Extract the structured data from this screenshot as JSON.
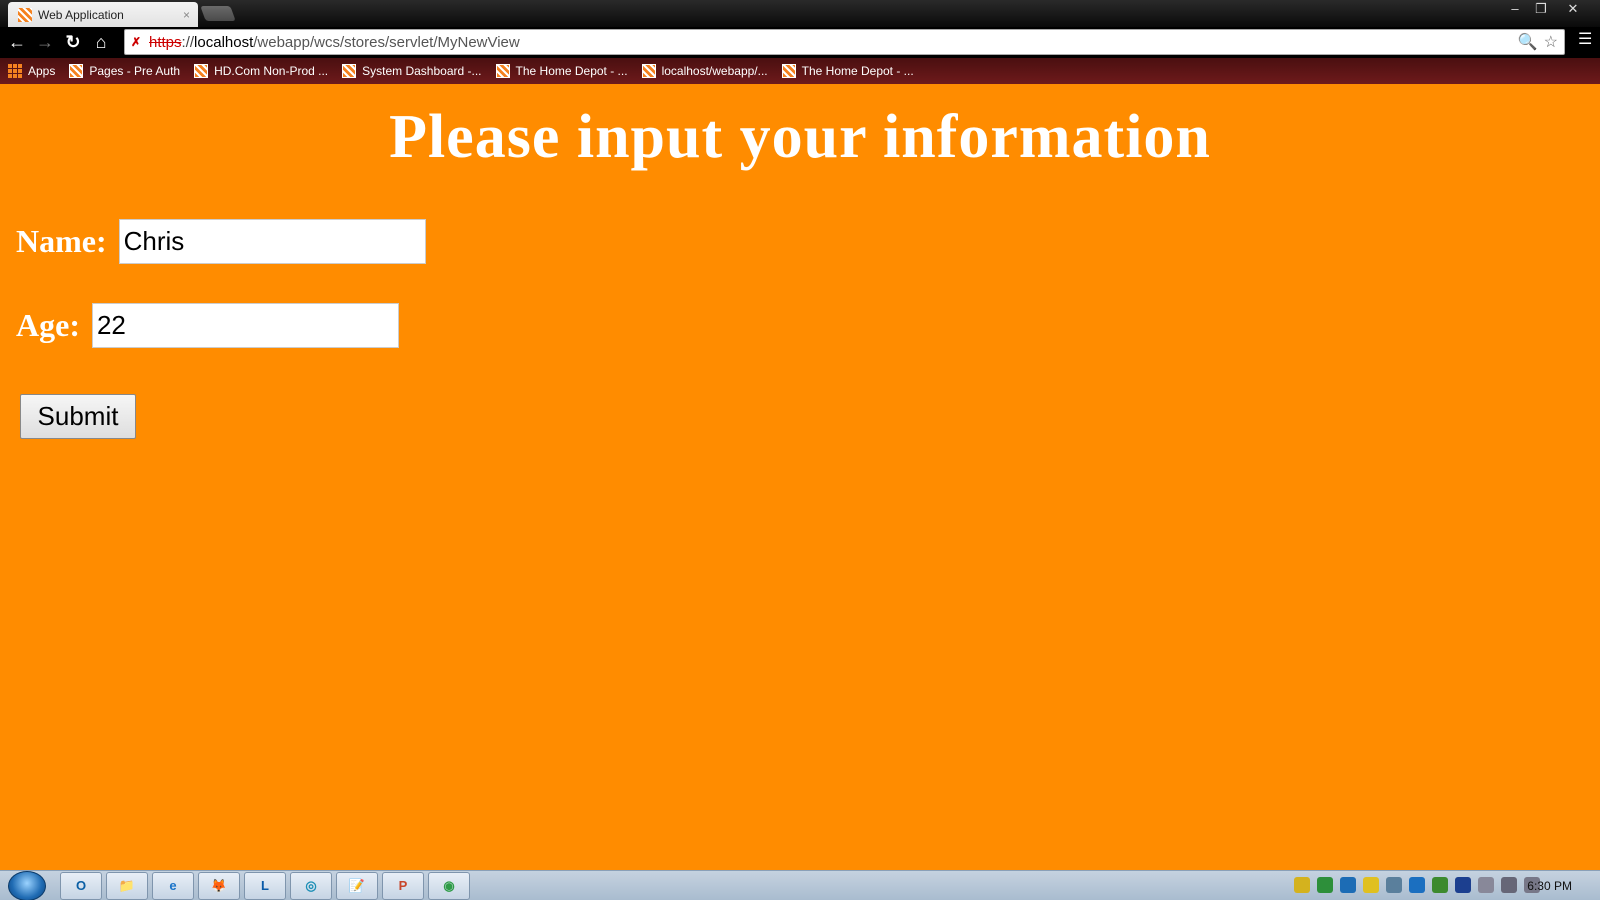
{
  "browser": {
    "tab": {
      "title": "Web Application",
      "close": "×"
    },
    "window_controls": {
      "minimize": "–",
      "restore": "❐",
      "close": "✕"
    },
    "url": {
      "scheme": "https",
      "separator": "://",
      "host": "localhost",
      "path": "/webapp/wcs/stores/servlet/MyNewView"
    },
    "bookmarks": [
      {
        "label": "Apps",
        "icon": "apps-grid-icon"
      },
      {
        "label": "Pages - Pre Auth",
        "icon": "home-depot-icon"
      },
      {
        "label": "HD.Com Non-Prod ...",
        "icon": "home-depot-icon"
      },
      {
        "label": "System Dashboard -...",
        "icon": "home-depot-icon"
      },
      {
        "label": "The Home Depot - ...",
        "icon": "home-depot-icon"
      },
      {
        "label": "localhost/webapp/...",
        "icon": "home-depot-icon"
      },
      {
        "label": "The Home Depot - ...",
        "icon": "home-depot-icon"
      }
    ]
  },
  "page": {
    "heading": "Please input your information",
    "name_label": "Name:",
    "name_value": "Chris",
    "age_label": "Age:",
    "age_value": "22",
    "submit_label": "Submit",
    "background_color": "#ff8c00"
  },
  "taskbar": {
    "apps": [
      "O",
      "📁",
      "e",
      "🦊",
      "L",
      "◎",
      "📝",
      "P",
      "◉"
    ],
    "clock": "6:30 PM"
  }
}
